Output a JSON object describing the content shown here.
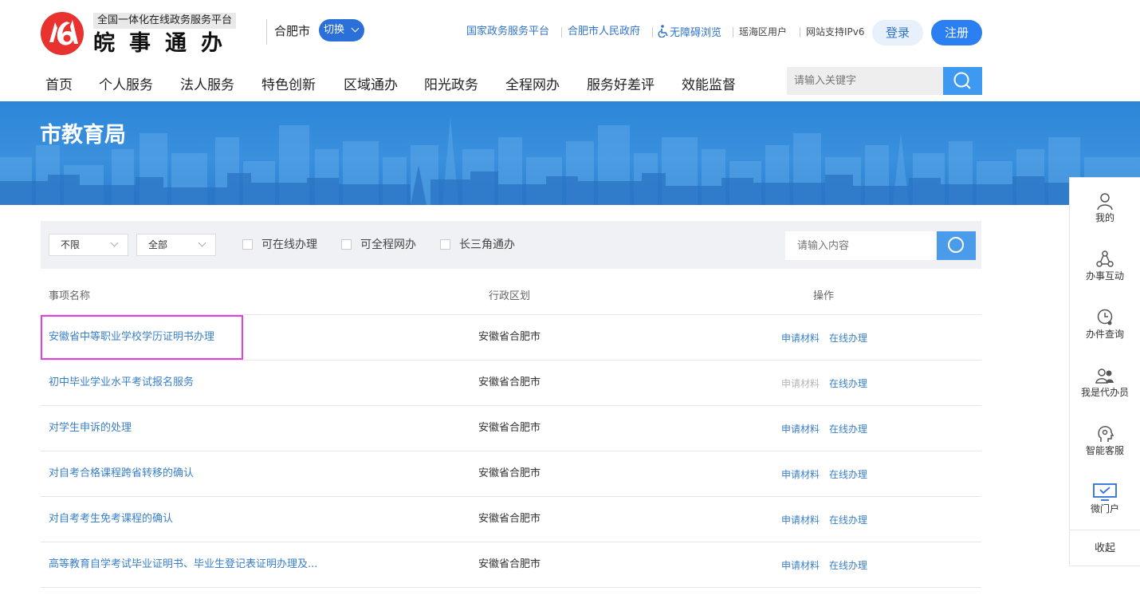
{
  "header": {
    "logo_subtitle": "全国一体化在线政务服务平台",
    "logo_title": "皖事通办",
    "city": "合肥市",
    "switch_label": "切换",
    "links": {
      "national": "国家政务服务平台",
      "city_gov": "合肥市人民政府",
      "accessible": "无障碍浏览",
      "district_user": "瑶海区用户",
      "ipv6": "网站支持IPv6"
    },
    "login_label": "登录",
    "register_label": "注册",
    "search_placeholder": "请输入关键字"
  },
  "nav": {
    "items": [
      "首页",
      "个人服务",
      "法人服务",
      "特色创新",
      "区域通办",
      "阳光政务",
      "全程网办",
      "服务好差评",
      "效能监督"
    ]
  },
  "banner": {
    "title": "市教育局"
  },
  "filters": {
    "select_1": "不限",
    "select_2": "全部",
    "checkboxes": [
      "可在线办理",
      "可全程网办",
      "长三角通办"
    ],
    "search_placeholder": "请输入内容"
  },
  "table": {
    "headers": {
      "name": "事项名称",
      "region": "行政区划",
      "ops": "操作"
    },
    "rows": [
      {
        "name": "安徽省中等职业学校学历证明书办理",
        "region": "安徽省合肥市",
        "materials": "申请材料",
        "online": "在线办理"
      },
      {
        "name": "初中毕业学业水平考试报名服务",
        "region": "安徽省合肥市",
        "materials": "申请材料",
        "online": "在线办理"
      },
      {
        "name": "对学生申诉的处理",
        "region": "安徽省合肥市",
        "materials": "申请材料",
        "online": "在线办理"
      },
      {
        "name": "对自考合格课程跨省转移的确认",
        "region": "安徽省合肥市",
        "materials": "申请材料",
        "online": "在线办理"
      },
      {
        "name": "对自考考生免考课程的确认",
        "region": "安徽省合肥市",
        "materials": "申请材料",
        "online": "在线办理"
      },
      {
        "name": "高等教育自学考试毕业证明书、毕业生登记表证明办理及...",
        "region": "安徽省合肥市",
        "materials": "申请材料",
        "online": "在线办理"
      }
    ]
  },
  "sidebar": {
    "items": [
      "我的",
      "办事互动",
      "办件查询",
      "我是代办员",
      "智能客服",
      "微门户"
    ],
    "collapse": "收起"
  },
  "colors": {
    "brand_red": "#e8322f",
    "primary_blue": "#2b7ff0",
    "link_blue": "#3a7fc9",
    "highlight": "#e23ee0"
  }
}
